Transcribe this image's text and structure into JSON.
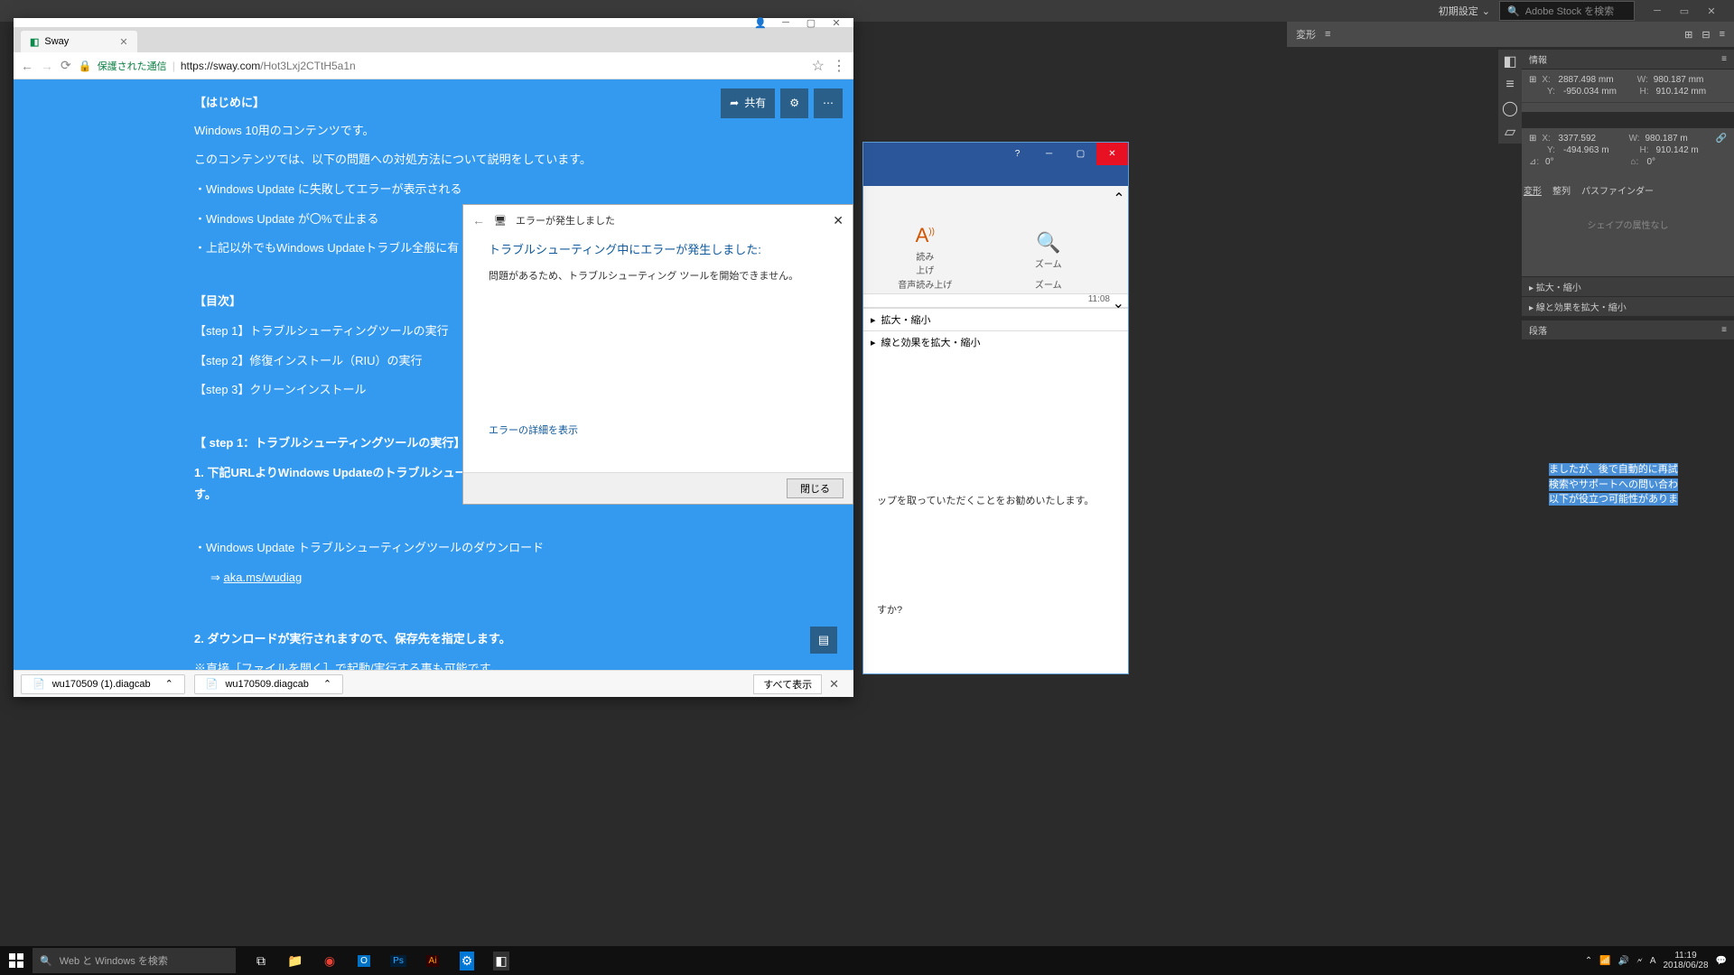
{
  "adobe": {
    "preset": "初期設定",
    "search_placeholder": "Adobe Stock を検索",
    "toolbar_label": "変形",
    "panels": {
      "info": "情報",
      "transform": "変形",
      "align": "整列",
      "pathfinder": "パスファインダー",
      "shape_none": "シェイプの属性なし",
      "expand_shrink": "拡大・縮小",
      "line_effect": "線と効果を拡大・縮小",
      "para": "段落"
    },
    "coords1": {
      "x": "2887.498 mm",
      "y": "-950.034 mm",
      "w": "980.187 mm",
      "h": "910.142 mm"
    },
    "coords2": {
      "x": "3377.592",
      "y": "-494.963 m",
      "w": "980.187 m",
      "h": "910.142 m",
      "angle": "0°",
      "shear": "0°"
    }
  },
  "highlighted": {
    "l1": "ましたが、後で自動的に再試",
    "l2": "検索やサポートへの問い合わ",
    "l3": "以下が役立つ可能性がありま"
  },
  "word": {
    "ribbon": {
      "read": "読み\n上げ",
      "zoom": "ズーム",
      "group_read": "音声読み上げ",
      "group_zoom": "ズーム"
    },
    "time": "11:08",
    "expand1": "拡大・縮小",
    "expand2": "線と効果を拡大・縮小",
    "body_text": "ップを取っていただくことをお勧めいたします。",
    "body_q": "すか?"
  },
  "browser": {
    "tab_title": "Sway",
    "secure": "保護された通信",
    "url_host": "https://sway.com",
    "url_path": "/Hot3Lxj2CTtH5a1n",
    "share": "共有",
    "show_all": "すべて表示",
    "downloads": [
      "wu170509 (1).diagcab",
      "wu170509.diagcab"
    ]
  },
  "sway": {
    "h_intro": "【はじめに】",
    "p1": "Windows 10用のコンテンツです。",
    "p2": "このコンテンツでは、以下の問題への対処方法について説明をしています。",
    "b1": "・Windows Update に失敗してエラーが表示される",
    "b2": "・Windows Update が〇%で止まる　　　　　　　　　　など",
    "b3": "・上記以外でもWindows Updateトラブル全般に有",
    "h_toc": "【目次】",
    "s1": "【step 1】トラブルシューティングツールの実行",
    "s2": "【step 2】修復インストール（RIU）の実行",
    "s3": "【step 3】クリーンインストール",
    "h_step1": "【 step 1：トラブルシューティングツールの実行】",
    "p3a": "1. 下記URLよりWindows Updateのトラブルシュー",
    "p3b": "す。",
    "b4": "・Windows Update トラブルシューティングツールのダウンロード",
    "link_arrow": "⇒  ",
    "link": "aka.ms/wudiag",
    "p4": "2. ダウンロードが実行されますので、保存先を指定します。",
    "p5": "※直接［ファイルを開く］で起動/実行する事も可能です。"
  },
  "trouble": {
    "title": "エラーが発生しました",
    "heading": "トラブルシューティング中にエラーが発生しました:",
    "body": "問題があるため、トラブルシューティング ツールを開始できません。",
    "detail": "エラーの詳細を表示",
    "close": "閉じる"
  },
  "taskbar": {
    "search": "Web と Windows を検索",
    "time": "11:19",
    "date": "2018/06/28",
    "ime": "A"
  }
}
